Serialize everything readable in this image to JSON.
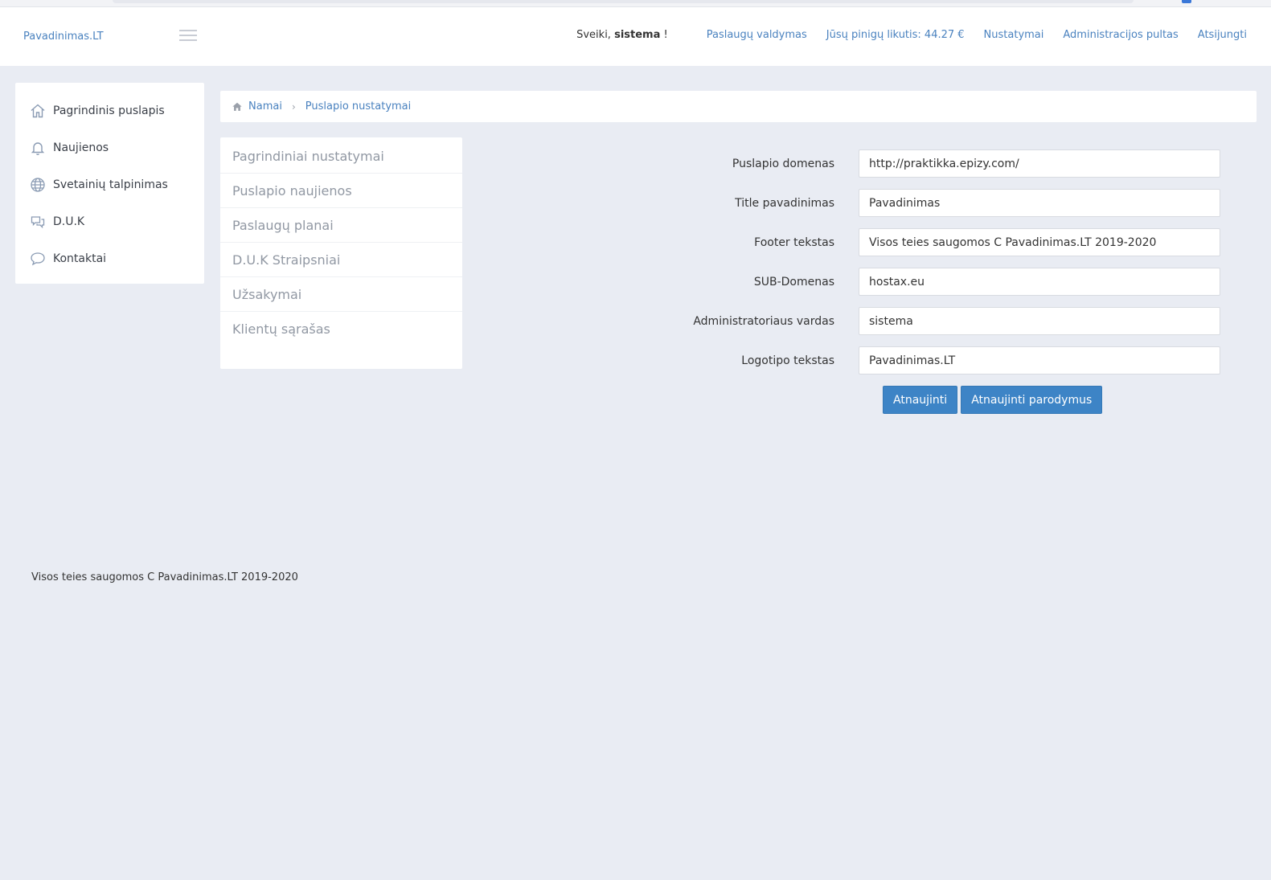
{
  "header": {
    "brand": "Pavadinimas.LT",
    "greeting_prefix": "Sveiki,",
    "greeting_user": "sistema",
    "greeting_suffix": "!",
    "nav": [
      {
        "label": "Paslaugų valdymas"
      },
      {
        "label": "Jūsų pinigų likutis: 44.27 €"
      },
      {
        "label": "Nustatymai"
      },
      {
        "label": "Administracijos pultas"
      },
      {
        "label": "Atsijungti"
      }
    ]
  },
  "sidebar": {
    "items": [
      {
        "label": "Pagrindinis puslapis",
        "icon": "home-icon"
      },
      {
        "label": "Naujienos",
        "icon": "bell-icon"
      },
      {
        "label": "Svetainių talpinimas",
        "icon": "globe-icon"
      },
      {
        "label": "D.U.K",
        "icon": "chat-bubbles-icon"
      },
      {
        "label": "Kontaktai",
        "icon": "chat-bubble-icon"
      }
    ]
  },
  "breadcrumb": {
    "home": "Namai",
    "current": "Puslapio nustatymai"
  },
  "submenu": {
    "items": [
      {
        "label": "Pagrindiniai nustatymai"
      },
      {
        "label": "Puslapio naujienos"
      },
      {
        "label": "Paslaugų planai"
      },
      {
        "label": "D.U.K Straipsniai"
      },
      {
        "label": "Užsakymai"
      },
      {
        "label": "Klientų sąrašas"
      }
    ]
  },
  "form": {
    "fields": [
      {
        "label": "Puslapio domenas",
        "value": "http://praktikka.epizy.com/"
      },
      {
        "label": "Title pavadinimas",
        "value": "Pavadinimas"
      },
      {
        "label": "Footer tekstas",
        "value": "Visos teies saugomos C Pavadinimas.LT 2019-2020"
      },
      {
        "label": "SUB-Domenas",
        "value": "hostax.eu"
      },
      {
        "label": "Administratoriaus vardas",
        "value": "sistema"
      },
      {
        "label": "Logotipo tekstas",
        "value": "Pavadinimas.LT"
      }
    ],
    "update_label": "Atnaujinti",
    "update_views_label": "Atnaujinti parodymus"
  },
  "footer": {
    "text": "Visos teies saugomos C Pavadinimas.LT 2019-2020"
  },
  "colors": {
    "accent": "#4a82bf",
    "button": "#3d84c6",
    "background": "#e9ecf3"
  }
}
